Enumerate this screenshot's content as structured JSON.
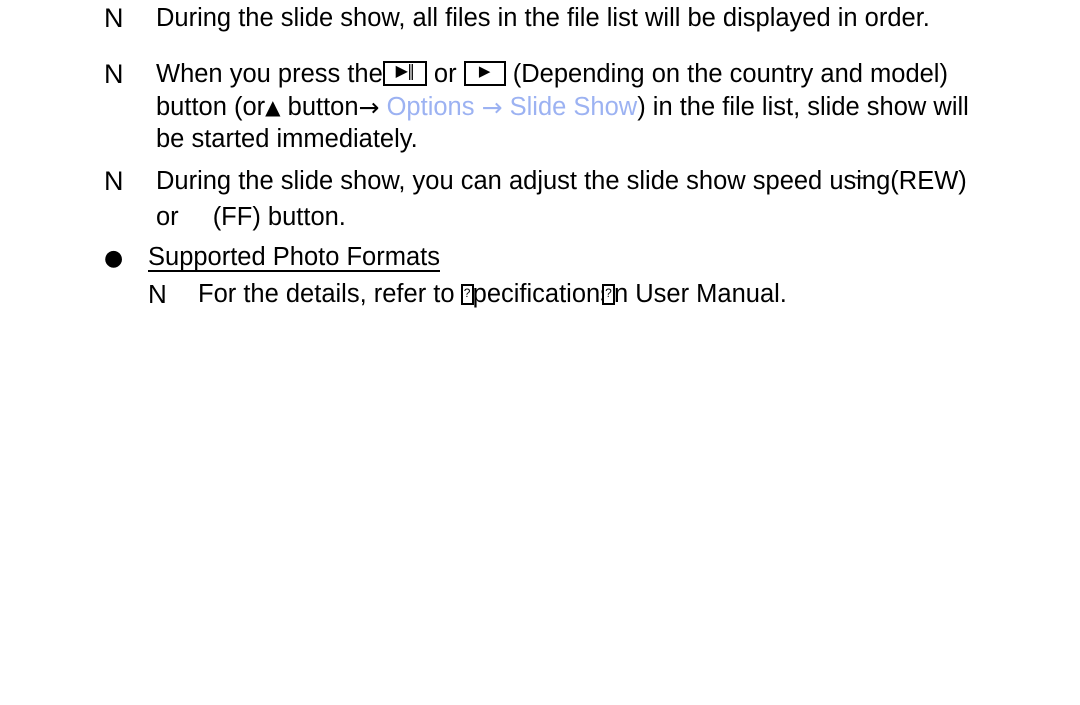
{
  "document": {
    "type": "tv-user-manual-help-page",
    "accent_color": "#9cb2f2",
    "text_color": "#000000",
    "background_color": "#ffffff"
  },
  "notes": {
    "marker": "N",
    "note_1": {
      "line_1": "During the slide show, all files in the file list will be displayed in order."
    },
    "note_2": {
      "line_1_a": "When you press the",
      "line_1_or": "or",
      "line_1_b": "(Depending on the country and model)",
      "line_2_a": "button (or",
      "line_2_b": "button",
      "line_2_options": "Options",
      "line_2_slideshow": "Slide Show",
      "line_2_c": ") in the file list, slide show will",
      "line_3": "be started immediately."
    },
    "note_3": {
      "line_1_a": "During the slide show, you can adjust the slide show speed usi",
      "line_1_b": "ng(REW)",
      "line_2_a": "or",
      "line_2_b": "(FF) button."
    },
    "note_4": {
      "line_1_a": "For the details, refer to",
      "line_1_b": "pecifications",
      "line_1_c": "n User Manual."
    }
  },
  "heading": {
    "bullet": "●",
    "label": "Supported Photo Formats"
  },
  "keys": {
    "play_pause": "▶‖",
    "play": "▶",
    "triangle_up": "▲",
    "arrow_right": "→"
  }
}
